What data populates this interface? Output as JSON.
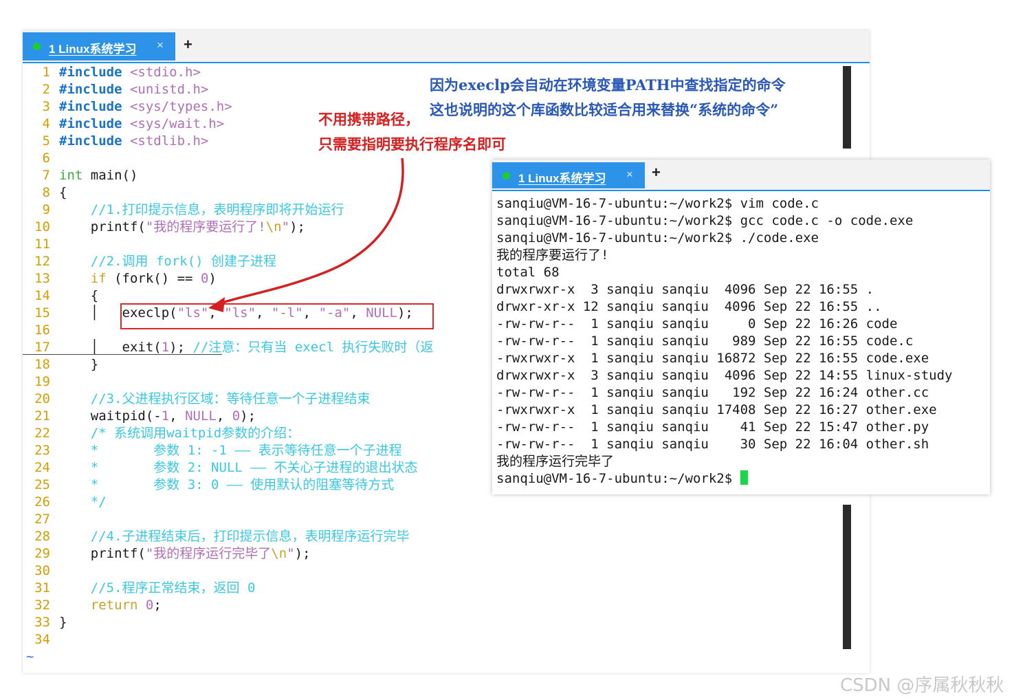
{
  "editor": {
    "tab_title": "1 Linux系统学习",
    "tab_close": "×",
    "new_tab": "+",
    "empty_marker": "~",
    "lines": [
      {
        "n": "1",
        "parts": [
          [
            "pp",
            "#include"
          ],
          [
            "",
            " "
          ],
          [
            "hdr",
            "<stdio.h>"
          ]
        ]
      },
      {
        "n": "2",
        "parts": [
          [
            "pp",
            "#include"
          ],
          [
            "",
            " "
          ],
          [
            "hdr",
            "<unistd.h>"
          ]
        ]
      },
      {
        "n": "3",
        "parts": [
          [
            "pp",
            "#include"
          ],
          [
            "",
            " "
          ],
          [
            "hdr",
            "<sys/types.h>"
          ]
        ]
      },
      {
        "n": "4",
        "parts": [
          [
            "pp",
            "#include"
          ],
          [
            "",
            " "
          ],
          [
            "hdr",
            "<sys/wait.h>"
          ]
        ]
      },
      {
        "n": "5",
        "parts": [
          [
            "pp",
            "#include"
          ],
          [
            "",
            " "
          ],
          [
            "hdr",
            "<stdlib.h>"
          ]
        ]
      },
      {
        "n": "6",
        "parts": []
      },
      {
        "n": "7",
        "parts": [
          [
            "kw",
            "int"
          ],
          [
            "",
            " main()"
          ]
        ]
      },
      {
        "n": "8",
        "parts": [
          [
            "",
            "{"
          ]
        ]
      },
      {
        "n": "9",
        "parts": [
          [
            "",
            "    "
          ],
          [
            "cm",
            "//1.打印提示信息，表明程序即将开始运行"
          ]
        ]
      },
      {
        "n": "10",
        "parts": [
          [
            "",
            "    printf("
          ],
          [
            "str",
            "\"我的程序要运行了!"
          ],
          [
            "esc",
            "\\n"
          ],
          [
            "str",
            "\""
          ],
          [
            "",
            ");"
          ]
        ]
      },
      {
        "n": "11",
        "parts": []
      },
      {
        "n": "12",
        "parts": [
          [
            "",
            "    "
          ],
          [
            "cm",
            "//2.调用 fork() 创建子进程"
          ]
        ]
      },
      {
        "n": "13",
        "parts": [
          [
            "",
            "    "
          ],
          [
            "kw2",
            "if"
          ],
          [
            "",
            " (fork() == "
          ],
          [
            "num",
            "0"
          ],
          [
            "",
            ")"
          ]
        ]
      },
      {
        "n": "14",
        "parts": [
          [
            "",
            "    {"
          ]
        ]
      },
      {
        "n": "15",
        "parts": [
          [
            "",
            "    │   execlp("
          ],
          [
            "str",
            "\"ls\""
          ],
          [
            "",
            ", "
          ],
          [
            "str",
            "\"ls\""
          ],
          [
            "",
            ", "
          ],
          [
            "str",
            "\"-l\""
          ],
          [
            "",
            ", "
          ],
          [
            "str",
            "\"-a\""
          ],
          [
            "",
            ", "
          ],
          [
            "str",
            "NULL"
          ],
          [
            "",
            ");"
          ]
        ]
      },
      {
        "n": "16",
        "parts": []
      },
      {
        "n": "17",
        "parts": [
          [
            "",
            "    │   exit("
          ],
          [
            "num",
            "1"
          ],
          [
            "",
            "); "
          ],
          [
            "cm",
            "//注意：只有当 execl 执行失败时（返"
          ]
        ]
      },
      {
        "n": "18",
        "parts": [
          [
            "",
            "    }"
          ]
        ]
      },
      {
        "n": "19",
        "parts": []
      },
      {
        "n": "20",
        "parts": [
          [
            "",
            "    "
          ],
          [
            "cm",
            "//3.父进程执行区域：等待任意一个子进程结束"
          ]
        ]
      },
      {
        "n": "21",
        "parts": [
          [
            "",
            "    waitpid(-"
          ],
          [
            "num",
            "1"
          ],
          [
            "",
            ", "
          ],
          [
            "str",
            "NULL"
          ],
          [
            "",
            ", "
          ],
          [
            "num",
            "0"
          ],
          [
            "",
            ");"
          ]
        ]
      },
      {
        "n": "22",
        "parts": [
          [
            "",
            "    "
          ],
          [
            "cm",
            "/* 系统调用waitpid参数的介绍："
          ]
        ]
      },
      {
        "n": "23",
        "parts": [
          [
            "",
            "    "
          ],
          [
            "cm",
            "*       参数 1: -1 —— 表示等待任意一个子进程"
          ]
        ]
      },
      {
        "n": "24",
        "parts": [
          [
            "",
            "    "
          ],
          [
            "cm",
            "*       参数 2: NULL —— 不关心子进程的退出状态"
          ]
        ]
      },
      {
        "n": "25",
        "parts": [
          [
            "",
            "    "
          ],
          [
            "cm",
            "*       参数 3: 0 —— 使用默认的阻塞等待方式"
          ]
        ]
      },
      {
        "n": "26",
        "parts": [
          [
            "",
            "    "
          ],
          [
            "cm",
            "*/"
          ]
        ]
      },
      {
        "n": "27",
        "parts": []
      },
      {
        "n": "28",
        "parts": [
          [
            "",
            "    "
          ],
          [
            "cm",
            "//4.子进程结束后，打印提示信息，表明程序运行完毕"
          ]
        ]
      },
      {
        "n": "29",
        "parts": [
          [
            "",
            "    printf("
          ],
          [
            "str",
            "\"我的程序运行完毕了"
          ],
          [
            "esc",
            "\\n"
          ],
          [
            "str",
            "\""
          ],
          [
            "",
            ");"
          ]
        ]
      },
      {
        "n": "30",
        "parts": []
      },
      {
        "n": "31",
        "parts": [
          [
            "",
            "    "
          ],
          [
            "cm",
            "//5.程序正常结束，返回 0"
          ]
        ]
      },
      {
        "n": "32",
        "parts": [
          [
            "",
            "    "
          ],
          [
            "kw2",
            "return"
          ],
          [
            "",
            " "
          ],
          [
            "num",
            "0"
          ],
          [
            "",
            ";"
          ]
        ]
      },
      {
        "n": "33",
        "parts": [
          [
            "",
            "}"
          ]
        ]
      },
      {
        "n": "34",
        "parts": []
      }
    ]
  },
  "annotations": {
    "blue_line1": "因为execlp会自动在环境变量PATH中查找指定的命令",
    "blue_line2": "这也说明的这个库函数比较适合用来替换“系统的命令”",
    "red_line1": "不用携带路径，",
    "red_line2": "只需要指明要执行程序名即可"
  },
  "terminal": {
    "tab_title": "1 Linux系统学习",
    "tab_close": "×",
    "new_tab": "+",
    "lines": [
      "sanqiu@VM-16-7-ubuntu:~/work2$ vim code.c",
      "sanqiu@VM-16-7-ubuntu:~/work2$ gcc code.c -o code.exe",
      "sanqiu@VM-16-7-ubuntu:~/work2$ ./code.exe",
      "我的程序要运行了!",
      "total 68",
      "drwxrwxr-x  3 sanqiu sanqiu  4096 Sep 22 16:55 .",
      "drwxr-xr-x 12 sanqiu sanqiu  4096 Sep 22 16:55 ..",
      "-rw-rw-r--  1 sanqiu sanqiu     0 Sep 22 16:26 code",
      "-rw-rw-r--  1 sanqiu sanqiu   989 Sep 22 16:55 code.c",
      "-rwxrwxr-x  1 sanqiu sanqiu 16872 Sep 22 16:55 code.exe",
      "drwxrwxr-x  3 sanqiu sanqiu  4096 Sep 22 14:55 linux-study",
      "-rw-rw-r--  1 sanqiu sanqiu   192 Sep 22 16:24 other.cc",
      "-rwxrwxr-x  1 sanqiu sanqiu 17408 Sep 22 16:27 other.exe",
      "-rw-rw-r--  1 sanqiu sanqiu    41 Sep 22 15:47 other.py",
      "-rw-rw-r--  1 sanqiu sanqiu    30 Sep 22 16:04 other.sh",
      "我的程序运行完毕了"
    ],
    "prompt": "sanqiu@VM-16-7-ubuntu:~/work2$ "
  },
  "watermark": "CSDN @序属秋秋秋",
  "colors": {
    "tab_blue": "#2d93e8",
    "status_green": "#1fce2c",
    "cursor_green": "#19d64a",
    "annotation_red": "#d42020",
    "annotation_blue": "#2a58b8"
  }
}
